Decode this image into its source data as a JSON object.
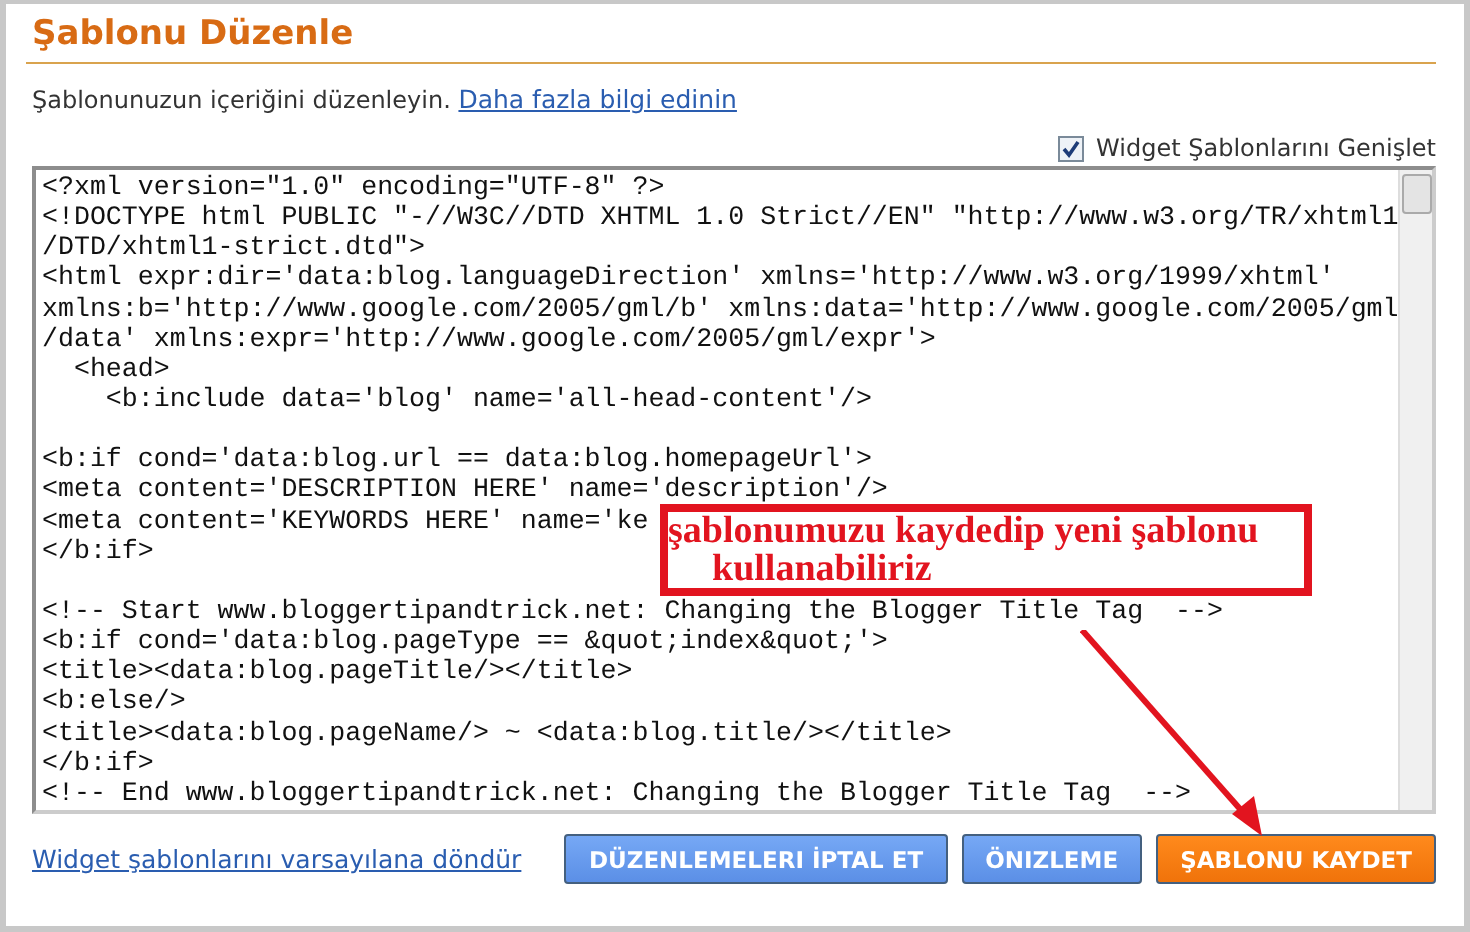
{
  "title": "Şablonu Düzenle",
  "intro": {
    "text": "Şablonunuzun içeriğini düzenleyin.",
    "link": "Daha fazla bilgi edinin"
  },
  "expand_widgets": {
    "label": "Widget Şablonlarını Genişlet",
    "checked": true
  },
  "code_blocks": [
    [
      "<?xml version=\"1.0\" encoding=\"UTF-8\" ?>",
      "<!DOCTYPE html PUBLIC \"-//W3C//DTD XHTML 1.0 Strict//EN\" \"http://www.w3.org/TR/xhtml1",
      "/DTD/xhtml1-strict.dtd\">",
      "<html expr:dir='data:blog.languageDirection' xmlns='http://www.w3.org/1999/xhtml'",
      "xmlns:b='http://www.google.com/2005/gml/b' xmlns:data='http://www.google.com/2005/gml",
      "/data' xmlns:expr='http://www.google.com/2005/gml/expr'>",
      "  <head>",
      "    <b:include data='blog' name='all-head-content'/>"
    ],
    [
      "<b:if cond='data:blog.url == data:blog.homepageUrl'>",
      "<meta content='DESCRIPTION HERE' name='description'/>",
      "<meta content='KEYWORDS HERE' name='ke",
      "</b:if>"
    ],
    [
      "<!-- Start www.bloggertipandtrick.net: Changing the Blogger Title Tag  -->",
      "<b:if cond='data:blog.pageType == &quot;index&quot;'>",
      "<title><data:blog.pageTitle/></title>",
      "<b:else/>",
      "<title><data:blog.pageName/> ~ <data:blog.title/></title>",
      "</b:if>",
      "<!-- End www.bloggertipandtrick.net: Changing the Blogger Title Tag  -->"
    ]
  ],
  "annotation": {
    "lines": [
      "şablonumuzu kaydedip yeni şablonu",
      "kullanabiliriz"
    ]
  },
  "reset_link": "Widget şablonlarını varsayılana döndür",
  "buttons": [
    {
      "label": "DÜZENLEMELERI İPTAL ET",
      "kind": "secondary"
    },
    {
      "label": "ÖNIZLEME",
      "kind": "secondary"
    },
    {
      "label": "ŞABLONU KAYDET",
      "kind": "primary"
    }
  ]
}
